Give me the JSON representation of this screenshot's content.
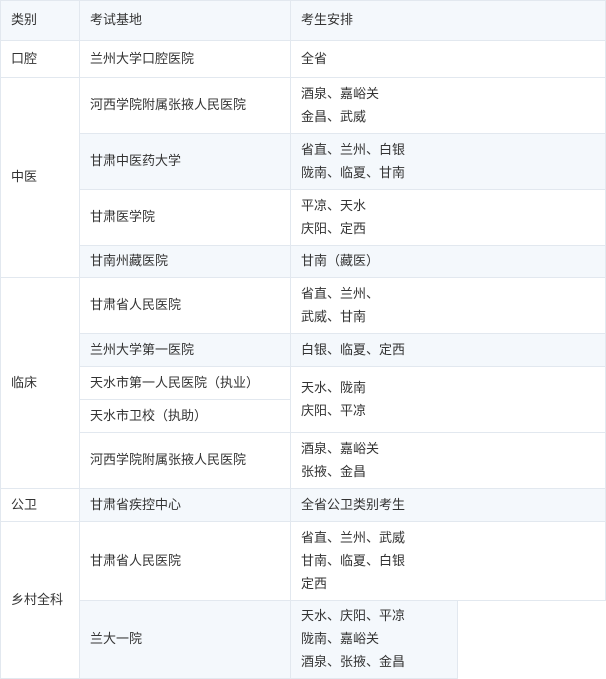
{
  "header": {
    "col1": "类别",
    "col2": "考试基地",
    "col3": "考生安排"
  },
  "categories": [
    "口腔",
    "中医",
    "临床",
    "公卫",
    "乡村全科"
  ],
  "rows": [
    {
      "base": "兰州大学口腔医院",
      "arrange": [
        "全省"
      ]
    },
    {
      "base": "河西学院附属张掖人民医院",
      "arrange": [
        "酒泉、嘉峪关",
        "金昌、武威"
      ]
    },
    {
      "base": "甘肃中医药大学",
      "arrange": [
        "省直、兰州、白银",
        "陇南、临夏、甘南"
      ]
    },
    {
      "base": "甘肃医学院",
      "arrange": [
        "平凉、天水",
        "庆阳、定西"
      ]
    },
    {
      "base": "甘南州藏医院",
      "arrange": [
        "甘南（藏医）"
      ]
    },
    {
      "base": "甘肃省人民医院",
      "arrange": [
        "省直、兰州、",
        "武威、甘南"
      ]
    },
    {
      "base": "兰州大学第一医院",
      "arrange": [
        "白银、临夏、定西"
      ]
    },
    {
      "base": "天水市第一人民医院（执业）"
    },
    {
      "base": "天水市卫校（执助）"
    },
    {
      "arrange": [
        "天水、陇南",
        "庆阳、平凉"
      ]
    },
    {
      "base": "河西学院附属张掖人民医院",
      "arrange": [
        "酒泉、嘉峪关",
        "张掖、金昌"
      ]
    },
    {
      "base": "甘肃省疾控中心",
      "arrange": [
        "全省公卫类别考生"
      ]
    },
    {
      "base": "甘肃省人民医院",
      "arrange": [
        "省直、兰州、武威",
        "甘南、临夏、白银",
        "定西"
      ]
    },
    {
      "base": "兰大一院",
      "arrange": [
        "天水、庆阳、平凉",
        "陇南、嘉峪关",
        "酒泉、张掖、金昌"
      ]
    }
  ]
}
